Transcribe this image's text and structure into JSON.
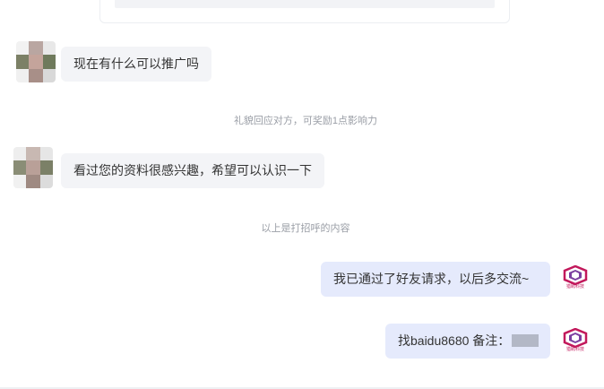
{
  "messages": {
    "incoming_1": "现在有什么可以推广吗",
    "system_1": "礼貌回应对方，可奖励1点影响力",
    "incoming_2": "看过您的资料很感兴趣，希望可以认识一下",
    "system_2": "以上是打招呼的内容",
    "outgoing_1": "我已通过了好友请求，以后多交流~",
    "outgoing_2": "找baidu8680 备注："
  },
  "brand": {
    "caption": "猎聘科技",
    "color": "#c2185b"
  },
  "avatars": {
    "avatar_1_colors": [
      "#f2f2f2",
      "#b9a6a1",
      "#e8e8e8",
      "#7c8066",
      "#c4a49b",
      "#6f7a5c",
      "#f0f0f0",
      "#a88f88",
      "#d9d9d9"
    ],
    "avatar_2_colors": [
      "#eeeeee",
      "#c8b8b2",
      "#e6e6e6",
      "#8a8d76",
      "#b9a098",
      "#7b8067",
      "#f1f1f1",
      "#9f8a82",
      "#dcdcdc"
    ]
  },
  "icons": {
    "avatar": "blurred-user-avatar",
    "brand": "brand-logo-icon"
  }
}
